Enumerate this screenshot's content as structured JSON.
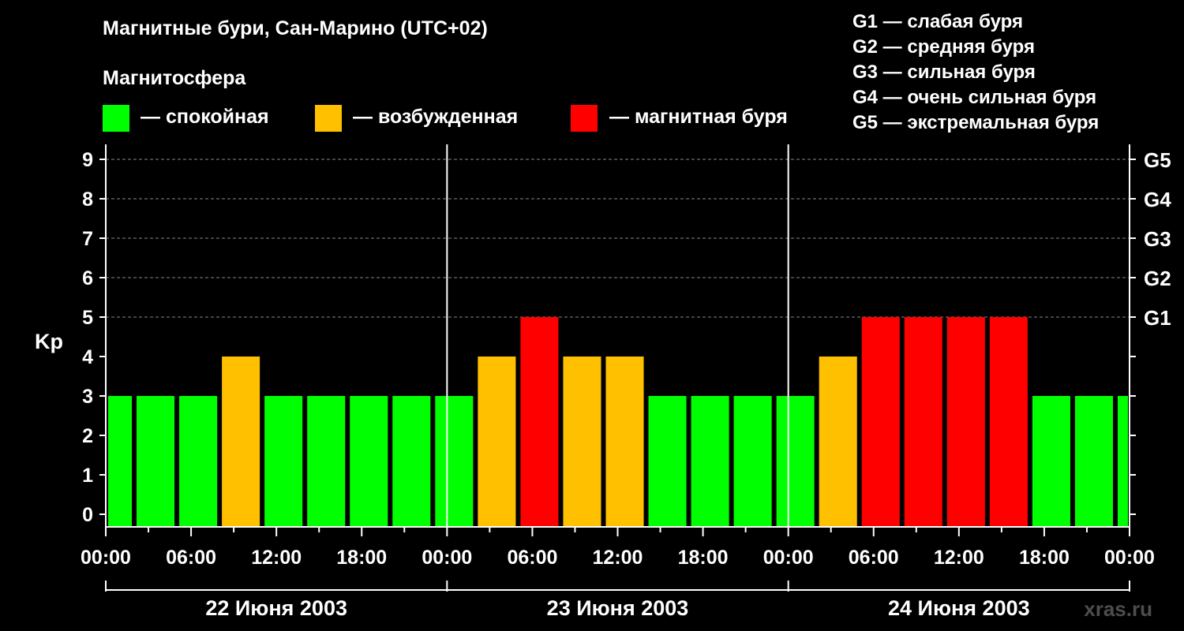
{
  "title": "Магнитные бури, Сан-Марино (UTC+02)",
  "magnetosphere": {
    "heading": "Магнитосфера",
    "items": [
      {
        "label": "— спокойная",
        "color": "#00ff00"
      },
      {
        "label": "— возбужденная",
        "color": "#ffc000"
      },
      {
        "label": "— магнитная буря",
        "color": "#ff0000"
      }
    ]
  },
  "g_scale": [
    "G1 — слабая буря",
    "G2 — средняя буря",
    "G3 — сильная буря",
    "G4 — очень сильная буря",
    "G5 — экстремальная буря"
  ],
  "watermark": "xras.ru",
  "chart_data": {
    "type": "bar",
    "ylabel": "Kp",
    "ylim": [
      0,
      9
    ],
    "y_ticks": [
      "0",
      "1",
      "2",
      "3",
      "4",
      "5",
      "6",
      "7",
      "8",
      "9"
    ],
    "right_ticks": [
      {
        "value": 5,
        "label": "G1"
      },
      {
        "value": 6,
        "label": "G2"
      },
      {
        "value": 7,
        "label": "G3"
      },
      {
        "value": 8,
        "label": "G4"
      },
      {
        "value": 9,
        "label": "G5"
      }
    ],
    "x_tick_labels": [
      "00:00",
      "06:00",
      "12:00",
      "18:00",
      "00:00",
      "06:00",
      "12:00",
      "18:00",
      "00:00",
      "06:00",
      "12:00",
      "18:00",
      "00:00"
    ],
    "days": [
      "22 Июня 2003",
      "23 Июня 2003",
      "24 Июня 2003"
    ],
    "grid": "dashed horizontal at Kp 5–9",
    "colors": {
      "quiet": "#00ff00",
      "active": "#ffc000",
      "storm": "#ff0000"
    },
    "series": [
      {
        "values": [
          3,
          3,
          3,
          4,
          3,
          3,
          3,
          3,
          3,
          4,
          5,
          4,
          4,
          3,
          3,
          3,
          3,
          4,
          5,
          5,
          5,
          5,
          3,
          3,
          3
        ],
        "start_hours": [
          0,
          2,
          5,
          8,
          11,
          14,
          17,
          20,
          23,
          26,
          29,
          32,
          35,
          38,
          41,
          44,
          47,
          50,
          53,
          56,
          59,
          62,
          65,
          68,
          71
        ],
        "end_hours": [
          2,
          5,
          8,
          11,
          14,
          17,
          20,
          23,
          26,
          29,
          32,
          35,
          38,
          41,
          44,
          47,
          50,
          53,
          56,
          59,
          62,
          65,
          68,
          71,
          72
        ]
      }
    ]
  }
}
